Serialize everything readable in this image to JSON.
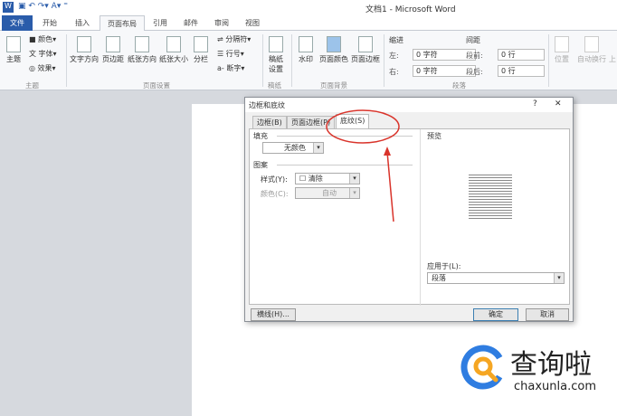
{
  "window": {
    "title": "文档1 - Microsoft Word"
  },
  "tabs": [
    "文件",
    "开始",
    "插入",
    "页面布局",
    "引用",
    "邮件",
    "审阅",
    "视图"
  ],
  "ribbon": {
    "theme": {
      "main": "主题",
      "colors": "颜色",
      "fonts": "字体",
      "effects": "效果",
      "group": "主题"
    },
    "page_setup": {
      "text_dir": "文字方向",
      "margins": "页边距",
      "orientation": "纸张方向",
      "size": "纸张大小",
      "columns": "分栏",
      "breaks": "分隔符",
      "line_numbers": "行号",
      "hyphenation": "断字",
      "group": "页面设置"
    },
    "draft": {
      "setup": "稿纸设置",
      "group": "稿纸"
    },
    "background": {
      "watermark": "水印",
      "page_color": "页面颜色",
      "page_borders": "页面边框",
      "group": "页面背景"
    },
    "paragraph": {
      "indent": "缩进",
      "left": "左:",
      "right": "右:",
      "left_val": "0 字符",
      "right_val": "0 字符",
      "spacing": "间距",
      "before": "段前:",
      "after": "段后:",
      "before_val": "0 行",
      "after_val": "0 行",
      "group": "段落"
    },
    "arrange": {
      "position": "位置",
      "wrap": "自动换行",
      "forward": "上"
    }
  },
  "dialog": {
    "title": "边框和底纹",
    "help": "?",
    "close": "✕",
    "tabs": [
      "边框(B)",
      "页面边框(P)",
      "底纹(S)"
    ],
    "fill_label": "填充",
    "fill_value": "无颜色",
    "pattern_label": "图案",
    "style_label": "样式(Y):",
    "style_value": "清除",
    "color_label": "颜色(C):",
    "color_value": "自动",
    "preview_label": "预览",
    "apply_label": "应用于(L):",
    "apply_value": "段落",
    "buttons": {
      "hline": "横线(H)...",
      "ok": "确定",
      "cancel": "取消"
    }
  },
  "watermark": {
    "brand": "查询啦",
    "url": "chaxunla.com"
  },
  "annotation_color": "#d9342b"
}
